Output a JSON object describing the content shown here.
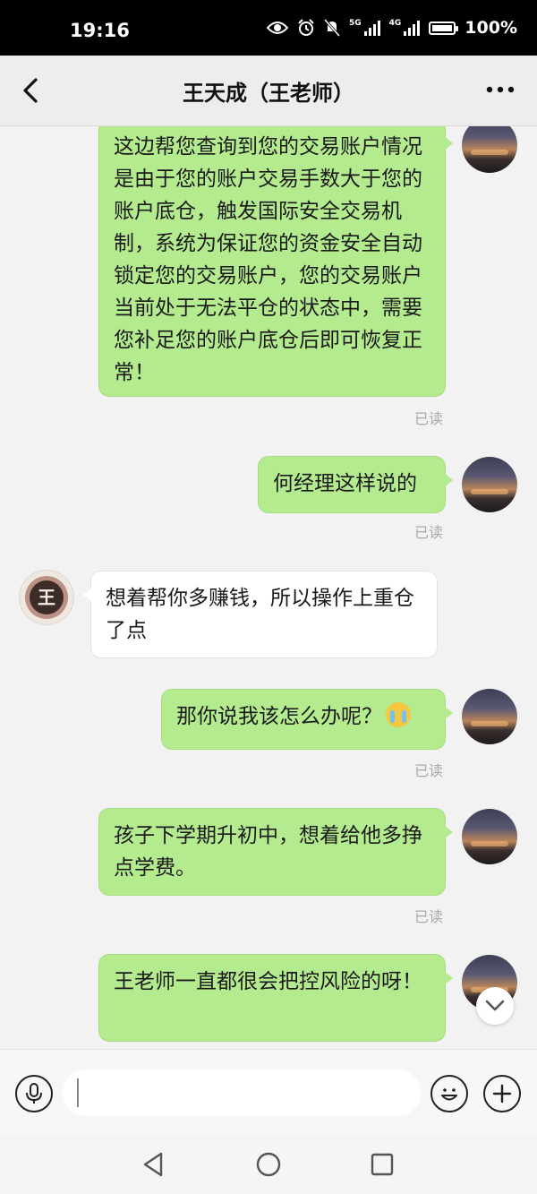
{
  "status_bar": {
    "time": "19:16",
    "network_1": "5G",
    "network_2": "4G",
    "battery": "100%",
    "icons": [
      "eye-icon",
      "alarm-icon",
      "mute-icon",
      "signal-icon",
      "battery-icon"
    ]
  },
  "header": {
    "title": "王天成（王老师）",
    "back_icon": "chevron-left-icon",
    "more_icon": "more-dots-icon"
  },
  "messages": [
    {
      "sender": "me",
      "text": "这边帮您查询到您的交易账户情况是由于您的账户交易手数大于您的账户底仓，触发国际安全交易机制，系统为保证您的资金安全自动锁定您的交易账户，您的交易账户当前处于无法平仓的状态中，需要您补足您的账户底仓后即可恢复正常！",
      "status": "已读"
    },
    {
      "sender": "me",
      "text": "何经理这样说的",
      "status": "已读"
    },
    {
      "sender": "teacher",
      "text": "想着帮你多赚钱，所以操作上重仓了点",
      "avatar_text": "王"
    },
    {
      "sender": "me",
      "text": "那你说我该怎么办呢？",
      "emoji": "crying-face-icon",
      "status": "已读"
    },
    {
      "sender": "me",
      "text": "孩子下学期升初中，想着给他多挣点学费。",
      "status": "已读"
    },
    {
      "sender": "me",
      "text": "王老师一直都很会把控风险的呀！"
    }
  ],
  "input_bar": {
    "voice_icon": "microphone-icon",
    "emoji_icon": "emoji-icon",
    "plus_icon": "plus-icon",
    "placeholder": ""
  },
  "colors": {
    "my_bubble": "#b5eb8f",
    "their_bubble": "#ffffff",
    "background": "#ededed"
  }
}
